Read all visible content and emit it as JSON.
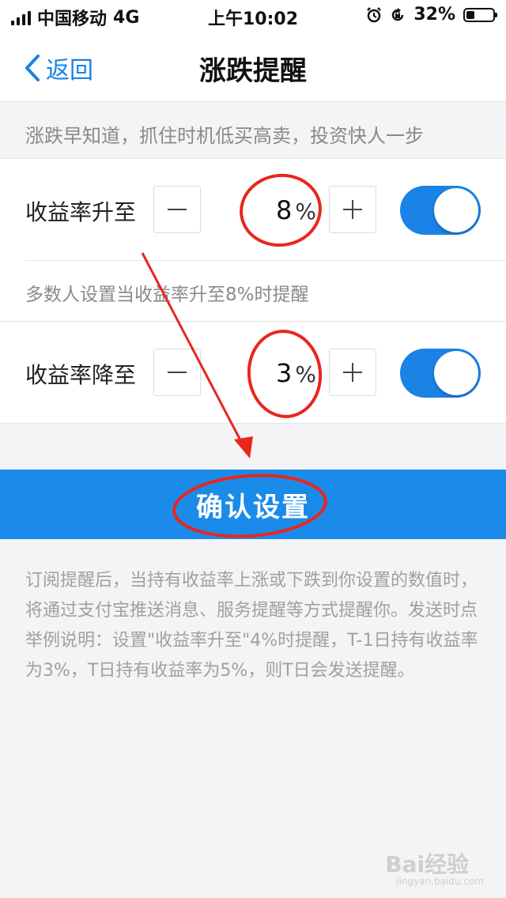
{
  "status_bar": {
    "carrier": "中国移动",
    "network": "4G",
    "time": "上午10:02",
    "battery": "32%",
    "battery_level": 0.32
  },
  "nav": {
    "back_label": "返回",
    "title": "涨跌提醒"
  },
  "tip": "涨跌早知道，抓住时机低买高卖，投资快人一步",
  "rise": {
    "label": "收益率升至",
    "value": "8",
    "unit": "%",
    "enabled": true,
    "hint": "多数人设置当收益率升至8%时提醒"
  },
  "fall": {
    "label": "收益率降至",
    "value": "3",
    "unit": "%",
    "enabled": true
  },
  "confirm_label": "确认设置",
  "notes": "订阅提醒后，当持有收益率上涨或下跌到你设置的数值时，将通过支付宝推送消息、服务提醒等方式提醒你。发送时点举例说明：设置\"收益率升至\"4%时提醒，T-1日持有收益率为3%，T日持有收益率为5%，则T日会发送提醒。",
  "watermark": {
    "brand": "Bai经验",
    "url": "jingyan.baidu.com"
  },
  "colors": {
    "accent": "#1b82e6",
    "annotation": "#e8261f"
  },
  "icons": [
    "signal-icon",
    "alarm-icon",
    "orientation-lock-icon",
    "battery-icon",
    "chevron-left-icon",
    "minus-icon",
    "plus-icon"
  ]
}
